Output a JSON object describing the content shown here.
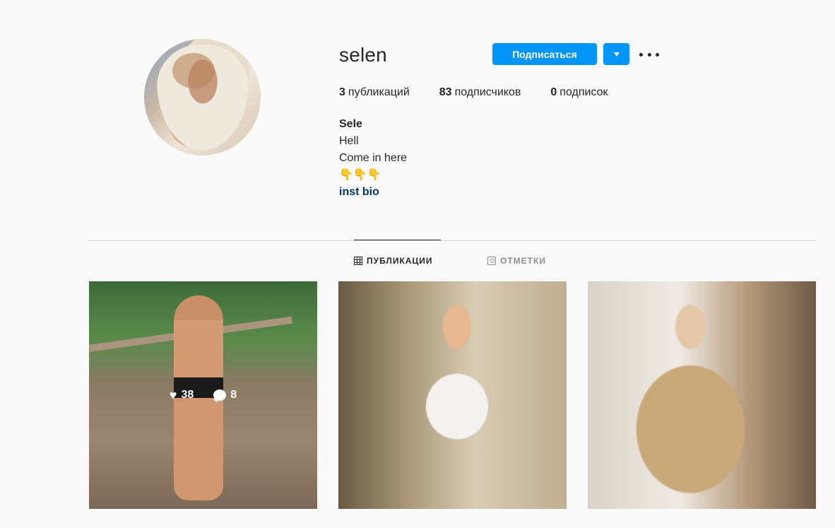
{
  "profile": {
    "username": "selen",
    "follow_label": "Подписаться",
    "stats": [
      {
        "value": "3",
        "label": "публикаций"
      },
      {
        "value": "83",
        "label": "подписчиков"
      },
      {
        "value": "0",
        "label": "подписок"
      }
    ],
    "bio": {
      "name": "Sele",
      "line1": "Hell",
      "line2": "Come in here",
      "emoji_line": "👇👇👇",
      "link": "inst bio"
    }
  },
  "tabs": [
    {
      "label": "ПУБЛИКАЦИИ",
      "icon": "grid-icon",
      "active": true
    },
    {
      "label": "ОТМЕТКИ",
      "icon": "tag-icon",
      "active": false
    }
  ],
  "posts": [
    {
      "likes": "38",
      "comments": "8",
      "hover": true
    },
    {
      "hover": false
    },
    {
      "hover": false
    }
  ],
  "colors": {
    "accent": "#0095f6",
    "text": "#262626",
    "muted": "#8e8e8e",
    "background": "#fafafa",
    "link": "#00376b"
  }
}
